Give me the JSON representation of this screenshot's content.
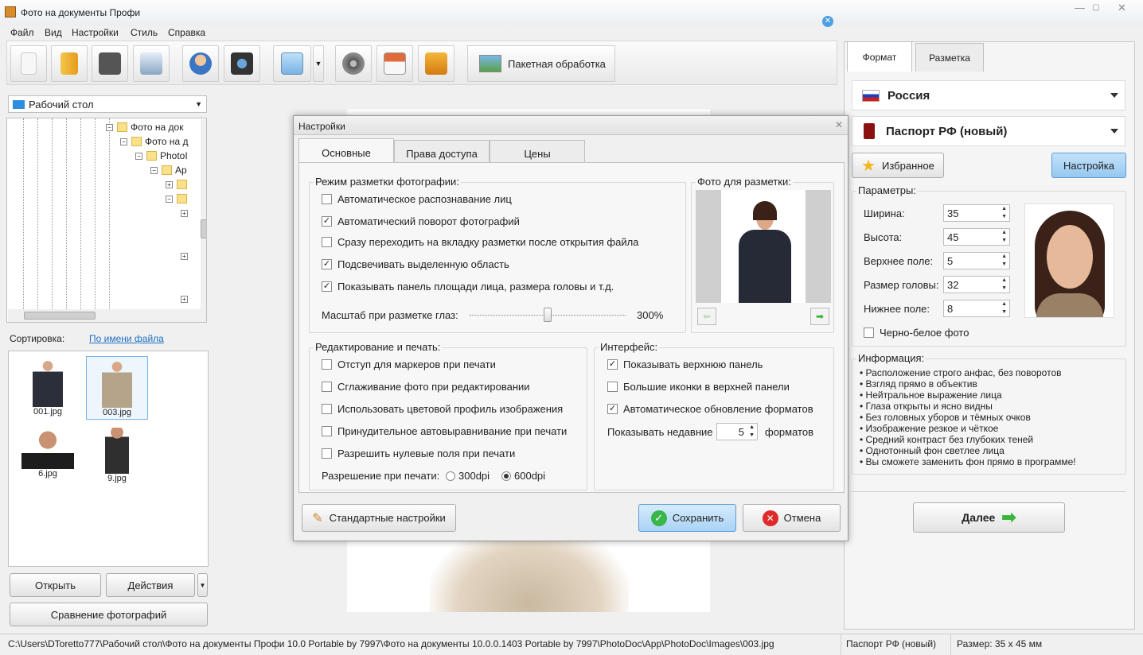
{
  "window": {
    "title": "Фото на документы Профи"
  },
  "menu": [
    "Файл",
    "Вид",
    "Настройки",
    "Стиль",
    "Справка"
  ],
  "toolbar": {
    "batch_label": "Пакетная обработка"
  },
  "left": {
    "folder_combo": "Рабочий стол",
    "tree": [
      "Фото на док",
      "Фото на д",
      "PhotoI",
      "Ap"
    ],
    "sort_label": "Сортировка:",
    "sort_value": "По имени файла",
    "files": [
      "001.jpg",
      "003.jpg",
      "6.jpg",
      "9.jpg"
    ],
    "open_btn": "Открыть",
    "actions_btn": "Действия",
    "compare_btn": "Сравнение фотографий"
  },
  "dialog": {
    "title": "Настройки",
    "tabs": [
      "Основные",
      "Права доступа",
      "Цены"
    ],
    "markup_group": "Режим разметки фотографии:",
    "markup_opts": [
      {
        "label": "Автоматическое распознавание лиц",
        "checked": ""
      },
      {
        "label": "Автоматический поворот фотографий",
        "checked": "✓"
      },
      {
        "label": "Сразу переходить на вкладку разметки после открытия файла",
        "checked": ""
      },
      {
        "label": "Подсвечивать выделенную область",
        "checked": "✓"
      },
      {
        "label": "Показывать панель площади лица, размера головы и т.д.",
        "checked": "✓"
      }
    ],
    "eye_scale_label": "Масштаб при разметке глаз:",
    "eye_scale_value": "300%",
    "eye_scale_fraction": 0.5,
    "photo_group": "Фото для разметки:",
    "edit_group": "Редактирование и печать:",
    "edit_opts": [
      {
        "label": "Отступ для маркеров при печати",
        "checked": ""
      },
      {
        "label": "Сглаживание фото при редактировании",
        "checked": ""
      },
      {
        "label": "Использовать цветовой профиль изображения",
        "checked": ""
      },
      {
        "label": "Принудительное автовыравнивание при печати",
        "checked": ""
      },
      {
        "label": "Разрешить нулевые поля при печати",
        "checked": ""
      }
    ],
    "resolution_label": "Разрешение при печати:",
    "res_300": "300dpi",
    "res_600": "600dpi",
    "ui_group": "Интерфейс:",
    "ui_opts": [
      {
        "label": "Показывать верхнюю панель",
        "checked": "✓"
      },
      {
        "label": "Большие иконки в верхней панели",
        "checked": ""
      },
      {
        "label": "Автоматическое обновление форматов",
        "checked": "✓"
      }
    ],
    "recent_label": "Показывать недавние",
    "recent_value": "5",
    "recent_suffix": "форматов",
    "defaults_btn": "Стандартные настройки",
    "save_btn": "Сохранить",
    "cancel_btn": "Отмена"
  },
  "right": {
    "tabs": [
      "Формат",
      "Разметка"
    ],
    "country": "Россия",
    "doc": "Паспорт РФ (новый)",
    "fav_btn": "Избранное",
    "setup_btn": "Настройка",
    "params_title": "Параметры:",
    "params": [
      {
        "label": "Ширина:",
        "value": "35"
      },
      {
        "label": "Высота:",
        "value": "45"
      },
      {
        "label": "Верхнее поле:",
        "value": "5"
      },
      {
        "label": "Размер головы:",
        "value": "32"
      },
      {
        "label": "Нижнее поле:",
        "value": "8"
      }
    ],
    "bw_label": "Черно-белое фото",
    "info_title": "Информация:",
    "info": [
      "Расположение строго анфас, без поворотов",
      "Взгляд прямо в объектив",
      "Нейтральное выражение лица",
      "Глаза открыты и ясно видны",
      "Без головных уборов и тёмных очков",
      "Изображение резкое и чёткое",
      "Средний контраст без глубоких теней",
      "Однотонный фон светлее лица",
      "Вы сможете заменить фон прямо в программе!"
    ],
    "next_btn": "Далее"
  },
  "status": {
    "path": "C:\\Users\\DToretto777\\Рабочий стол\\Фото на документы Профи 10.0 Portable by 7997\\Фото на документы 10.0.0.1403 Portable by 7997\\PhotoDoc\\App\\PhotoDoc\\Images\\003.jpg",
    "format": "Паспорт РФ (новый)",
    "size": "Размер: 35 x 45 мм"
  },
  "colors": {
    "accent_button": "#a9d3f5",
    "save_button": "#bfe0fa"
  }
}
